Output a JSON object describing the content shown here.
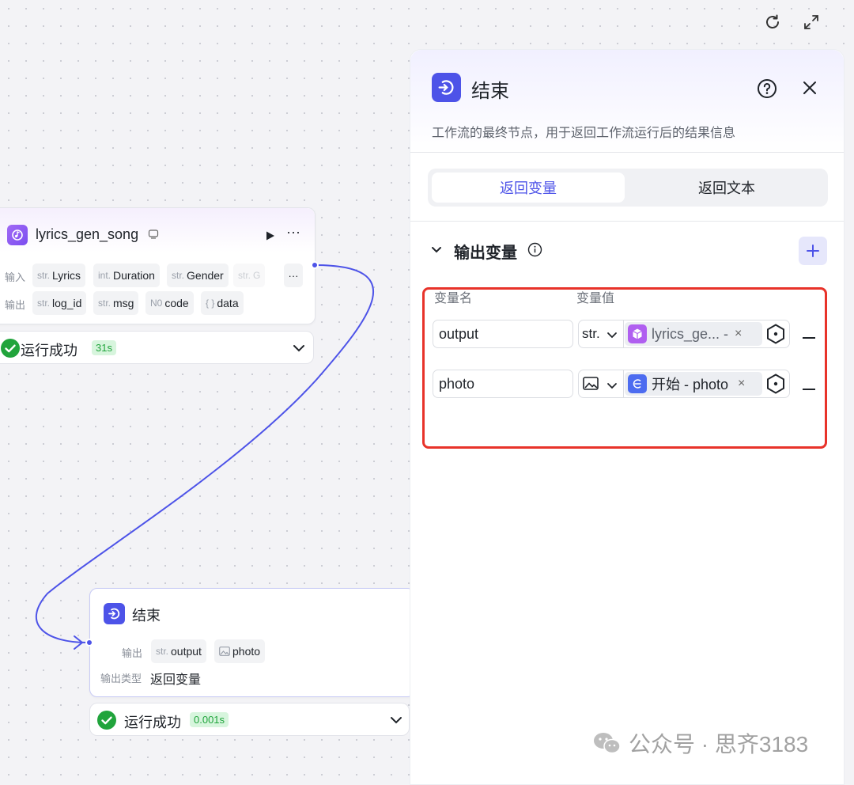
{
  "toolbar": {
    "refresh_icon": "refresh-icon",
    "expand_icon": "expand-icon"
  },
  "canvas": {
    "gen_node": {
      "title": "lyrics_gen_song",
      "input_label": "输入",
      "output_label": "输出",
      "inputs": [
        {
          "type": "str.",
          "name": "Lyrics"
        },
        {
          "type": "int.",
          "name": "Duration"
        },
        {
          "type": "str.",
          "name": "Gender"
        },
        {
          "type": "str.",
          "name": "G"
        }
      ],
      "more_inputs": "···",
      "outputs": [
        {
          "type": "str.",
          "name": "log_id"
        },
        {
          "type": "str.",
          "name": "msg"
        },
        {
          "type": "N0",
          "name": "code"
        },
        {
          "type": "{ }",
          "name": "data"
        }
      ],
      "status": "运行成功",
      "time": "31s"
    },
    "end_node": {
      "title": "结束",
      "output_label": "输出",
      "outputs": [
        {
          "type": "str.",
          "name": "output"
        },
        {
          "type": "image-icon",
          "name": "photo"
        }
      ],
      "output_type_label": "输出类型",
      "output_type_value": "返回变量",
      "status": "运行成功",
      "time": "0.001s"
    }
  },
  "panel": {
    "title": "结束",
    "description": "工作流的最终节点，用于返回工作流运行后的结果信息",
    "tabs": [
      {
        "label": "返回变量",
        "active": true
      },
      {
        "label": "返回文本",
        "active": false
      }
    ],
    "section_title": "输出变量",
    "col_name": "变量名",
    "col_value": "变量值",
    "rows": [
      {
        "name": "output",
        "type": "str.",
        "ref_text": "lyrics_ge... -",
        "ref_icon": "cube-icon"
      },
      {
        "name": "photo",
        "type": "image-icon",
        "ref_text": "开始 - photo",
        "ref_icon": "start-icon"
      }
    ]
  },
  "watermark": "公众号 · 思齐3183",
  "colors": {
    "accent": "#4d53e8",
    "highlight_border": "#e8332a",
    "success": "#21a43c"
  }
}
